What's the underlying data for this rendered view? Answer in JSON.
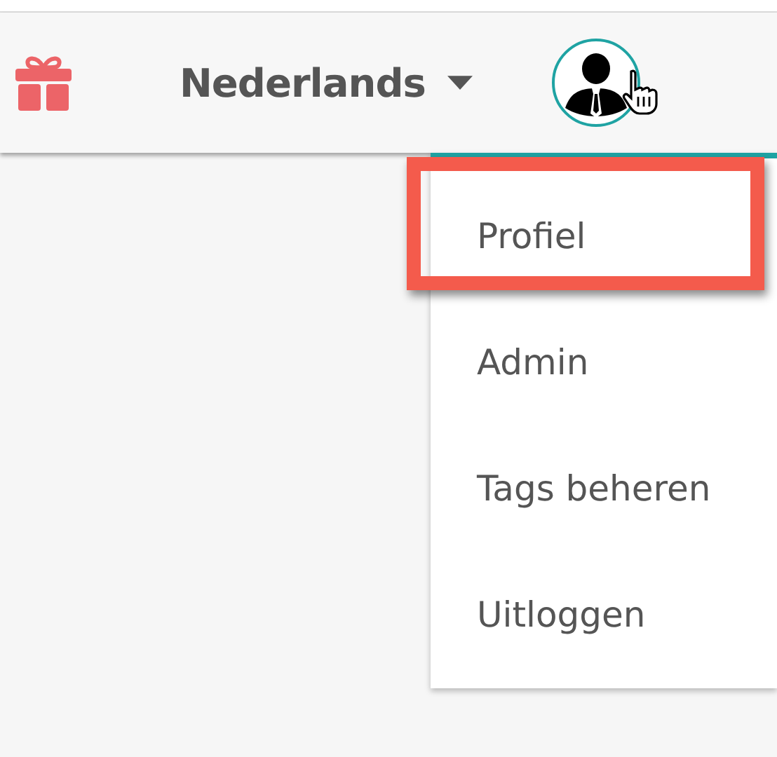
{
  "header": {
    "language": "Nederlands"
  },
  "user_menu": {
    "expanded": true,
    "items": [
      {
        "label": "Profiel",
        "highlighted": true
      },
      {
        "label": "Admin",
        "highlighted": false
      },
      {
        "label": "Tags beheren",
        "highlighted": false
      },
      {
        "label": "Uitloggen",
        "highlighted": false
      }
    ]
  }
}
